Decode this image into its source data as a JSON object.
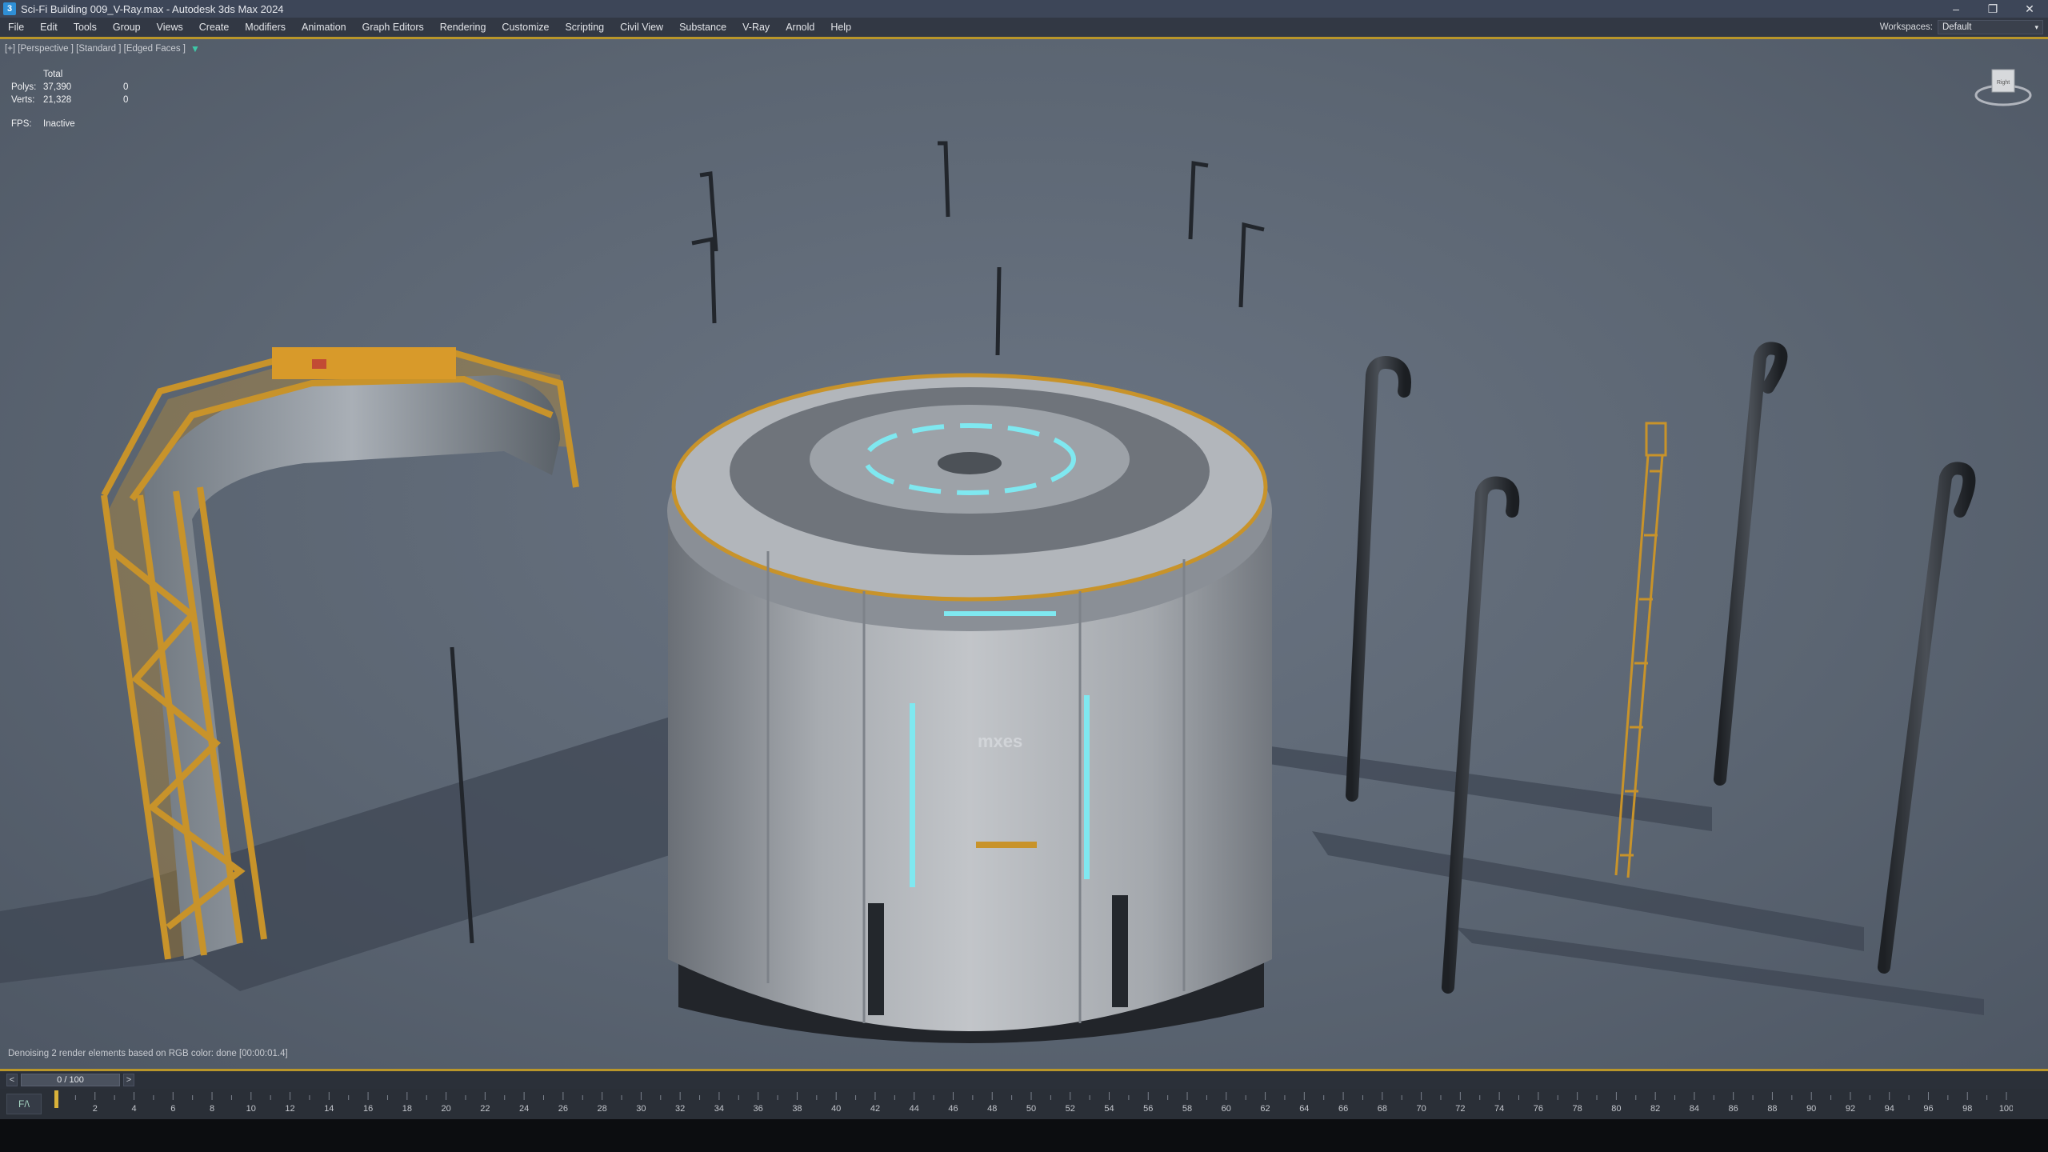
{
  "window": {
    "app_icon_letter": "3",
    "title": "Sci-Fi Building 009_V-Ray.max - Autodesk 3ds Max 2024",
    "controls": [
      "minimize-icon",
      "restore-icon",
      "close-icon"
    ]
  },
  "menu": {
    "items": [
      "File",
      "Edit",
      "Tools",
      "Group",
      "Views",
      "Create",
      "Modifiers",
      "Animation",
      "Graph Editors",
      "Rendering",
      "Customize",
      "Scripting",
      "Civil View",
      "Substance",
      "V-Ray",
      "Arnold",
      "Help"
    ],
    "workspaces_label": "Workspaces:",
    "workspace_value": "Default"
  },
  "viewport": {
    "label": "[+] [Perspective ] [Standard ] [Edged Faces ]",
    "filter_icon": "filter-icon",
    "stats": {
      "header": "Total",
      "polys_label": "Polys:",
      "polys_total": "37,390",
      "polys_selected": "0",
      "verts_label": "Verts:",
      "verts_total": "21,328",
      "verts_selected": "0",
      "fps_label": "FPS:",
      "fps_value": "Inactive"
    },
    "viewcube_label": "Right",
    "status_message": "Denoising 2 render elements based on RGB color: done [00:00:01.4]",
    "building_logo": "mxes"
  },
  "timeline": {
    "prev_label": "<",
    "next_label": ">",
    "slider_value": "0 / 100",
    "current_frame": 0,
    "total_frames": 100,
    "tick_labels": [
      "2",
      "4",
      "6",
      "8",
      "10",
      "12",
      "14",
      "16",
      "18",
      "20",
      "22",
      "24",
      "26",
      "28",
      "30",
      "32",
      "34",
      "36",
      "38",
      "40",
      "42",
      "44",
      "46",
      "48",
      "50",
      "52",
      "54",
      "56",
      "58",
      "60",
      "62",
      "64",
      "66",
      "68",
      "70",
      "72",
      "74",
      "76",
      "78",
      "80",
      "82",
      "84",
      "86",
      "88",
      "90",
      "92",
      "94",
      "96",
      "98",
      "100"
    ],
    "track_icon": "key-filter-icon"
  },
  "colors": {
    "title_bar": "#3d4658",
    "menu_bar": "#323844",
    "viewport_bg": "#5c6673",
    "active_border": "#b9962a",
    "accent_cyan": "#7fe8f0",
    "rail_orange": "#c8932a"
  }
}
